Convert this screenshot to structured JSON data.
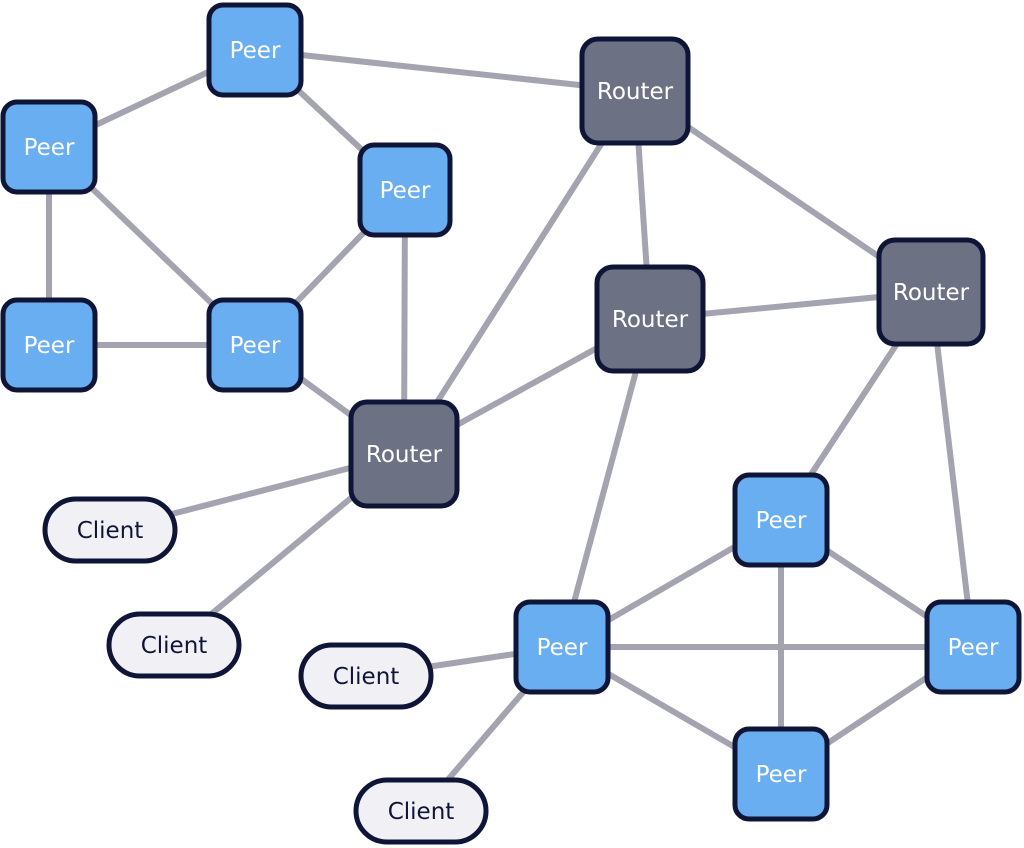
{
  "diagram": {
    "title": "",
    "node_types": {
      "peer": {
        "label": "Peer",
        "fill": "#6aaef2",
        "text_color": "#ffffff"
      },
      "router": {
        "label": "Router",
        "fill": "#6d7184",
        "text_color": "#ffffff"
      },
      "client": {
        "label": "Client",
        "fill": "#f1f1f5",
        "text_color": "#0f1537"
      }
    },
    "colors": {
      "border": "#0f1537",
      "edge": "#a3a4b0",
      "background": "#ffffff"
    },
    "nodes": [
      {
        "id": "peer-top",
        "type": "peer",
        "label": "Peer"
      },
      {
        "id": "peer-left-upper",
        "type": "peer",
        "label": "Peer"
      },
      {
        "id": "peer-mid",
        "type": "peer",
        "label": "Peer"
      },
      {
        "id": "peer-left-lower",
        "type": "peer",
        "label": "Peer"
      },
      {
        "id": "peer-center-left",
        "type": "peer",
        "label": "Peer"
      },
      {
        "id": "router-top",
        "type": "router",
        "label": "Router"
      },
      {
        "id": "router-center",
        "type": "router",
        "label": "Router"
      },
      {
        "id": "router-right",
        "type": "router",
        "label": "Router"
      },
      {
        "id": "router-bottom-left",
        "type": "router",
        "label": "Router"
      },
      {
        "id": "client-1",
        "type": "client",
        "label": "Client"
      },
      {
        "id": "client-2",
        "type": "client",
        "label": "Client"
      },
      {
        "id": "client-3",
        "type": "client",
        "label": "Client"
      },
      {
        "id": "client-4",
        "type": "client",
        "label": "Client"
      },
      {
        "id": "peer-hub",
        "type": "peer",
        "label": "Peer"
      },
      {
        "id": "peer-br-top",
        "type": "peer",
        "label": "Peer"
      },
      {
        "id": "peer-br-right",
        "type": "peer",
        "label": "Peer"
      },
      {
        "id": "peer-br-bottom",
        "type": "peer",
        "label": "Peer"
      }
    ],
    "edges": [
      [
        "peer-top",
        "peer-left-upper"
      ],
      [
        "peer-top",
        "router-top"
      ],
      [
        "peer-top",
        "peer-mid"
      ],
      [
        "peer-left-upper",
        "peer-left-lower"
      ],
      [
        "peer-left-upper",
        "peer-center-left"
      ],
      [
        "peer-left-lower",
        "peer-center-left"
      ],
      [
        "peer-mid",
        "peer-center-left"
      ],
      [
        "peer-mid",
        "router-bottom-left"
      ],
      [
        "peer-center-left",
        "router-bottom-left"
      ],
      [
        "router-top",
        "router-center"
      ],
      [
        "router-top",
        "router-right"
      ],
      [
        "router-top",
        "router-bottom-left"
      ],
      [
        "router-center",
        "router-right"
      ],
      [
        "router-center",
        "router-bottom-left"
      ],
      [
        "router-center",
        "peer-hub"
      ],
      [
        "router-right",
        "peer-br-top"
      ],
      [
        "router-right",
        "peer-br-right"
      ],
      [
        "router-bottom-left",
        "client-1"
      ],
      [
        "router-bottom-left",
        "client-2"
      ],
      [
        "peer-hub",
        "client-3"
      ],
      [
        "peer-hub",
        "client-4"
      ],
      [
        "peer-hub",
        "peer-br-top"
      ],
      [
        "peer-hub",
        "peer-br-right"
      ],
      [
        "peer-hub",
        "peer-br-bottom"
      ],
      [
        "peer-br-top",
        "peer-br-right"
      ],
      [
        "peer-br-top",
        "peer-br-bottom"
      ],
      [
        "peer-br-right",
        "peer-br-bottom"
      ]
    ]
  }
}
